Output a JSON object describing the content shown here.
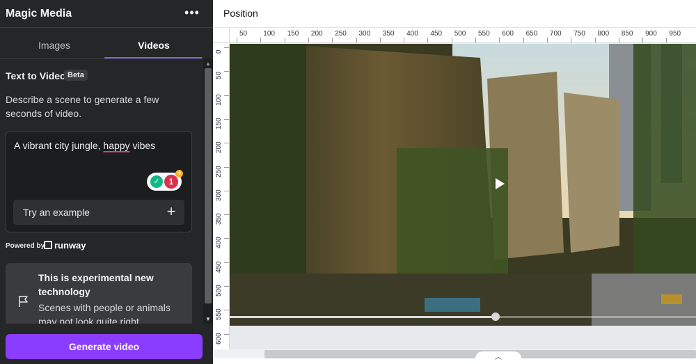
{
  "panel": {
    "title": "Magic Media",
    "more_icon": "more-horizontal-icon",
    "tabs": [
      {
        "label": "Images",
        "active": false
      },
      {
        "label": "Videos",
        "active": true
      }
    ],
    "section_title": "Text to Video",
    "beta_badge": "Beta",
    "description": "Describe a scene to generate a few seconds of video.",
    "prompt": {
      "value_before": "A vibrant city jungle, ",
      "value_misspelled": "happy",
      "value_after": " vibes",
      "grammar_count": "1"
    },
    "try_example_label": "Try an example",
    "powered_by": "Powered by",
    "runway_label": "runway",
    "info_card": {
      "title": "This is experimental new technology",
      "body": "Scenes with people or animals may not look quite right"
    },
    "generate_label": "Generate video"
  },
  "editor": {
    "header_label": "Position",
    "ruler_h": [
      "50",
      "100",
      "150",
      "200",
      "250",
      "300",
      "350",
      "400",
      "450",
      "500",
      "550",
      "600",
      "650",
      "700",
      "750",
      "800",
      "850",
      "900",
      "950"
    ],
    "ruler_v": [
      "0",
      "50",
      "100",
      "150",
      "200",
      "250",
      "300",
      "350",
      "400",
      "450",
      "500",
      "550",
      "600"
    ],
    "video_progress": 0.57
  },
  "colors": {
    "accent": "#8b3dff",
    "tab_underline": "#8b5cf6",
    "panel_bg": "#252627"
  }
}
